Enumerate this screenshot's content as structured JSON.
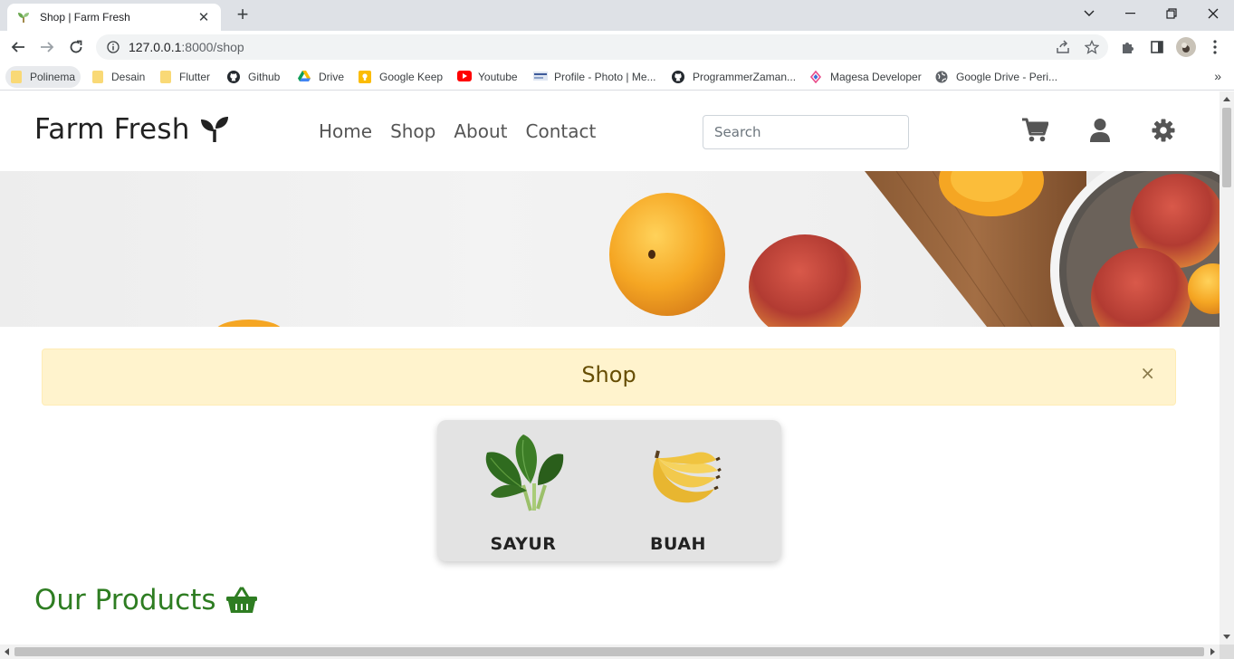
{
  "browser": {
    "tab_title": "Shop | Farm Fresh",
    "url_host": "127.0.0.1",
    "url_path": ":8000/shop",
    "bookmarks": [
      {
        "label": "Polinema",
        "icon": "folder-icon"
      },
      {
        "label": "Desain",
        "icon": "folder-icon"
      },
      {
        "label": "Flutter",
        "icon": "folder-icon"
      },
      {
        "label": "Github",
        "icon": "github-icon"
      },
      {
        "label": "Drive",
        "icon": "google-drive-icon"
      },
      {
        "label": "Google Keep",
        "icon": "google-keep-icon"
      },
      {
        "label": "Youtube",
        "icon": "youtube-icon"
      },
      {
        "label": "Profile - Photo | Me...",
        "icon": "profile-site-icon"
      },
      {
        "label": "ProgrammerZaman...",
        "icon": "github-icon"
      },
      {
        "label": "Magesa Developer",
        "icon": "magesa-icon"
      },
      {
        "label": "Google Drive - Peri...",
        "icon": "globe-icon"
      }
    ],
    "more_bookmarks": "»"
  },
  "site": {
    "logo_text": "Farm Fresh",
    "nav": [
      "Home",
      "Shop",
      "About",
      "Contact"
    ],
    "search_placeholder": "Search"
  },
  "alert": {
    "title": "Shop",
    "close": "×"
  },
  "categories": [
    {
      "label": "SAYUR",
      "image": "spinach-image"
    },
    {
      "label": "BUAH",
      "image": "banana-image"
    }
  ],
  "products_heading": "Our Products",
  "colors": {
    "brand_green": "#2e7d22",
    "alert_bg": "#fff3cd",
    "alert_text": "#664d03",
    "icon_gray": "#555555"
  }
}
